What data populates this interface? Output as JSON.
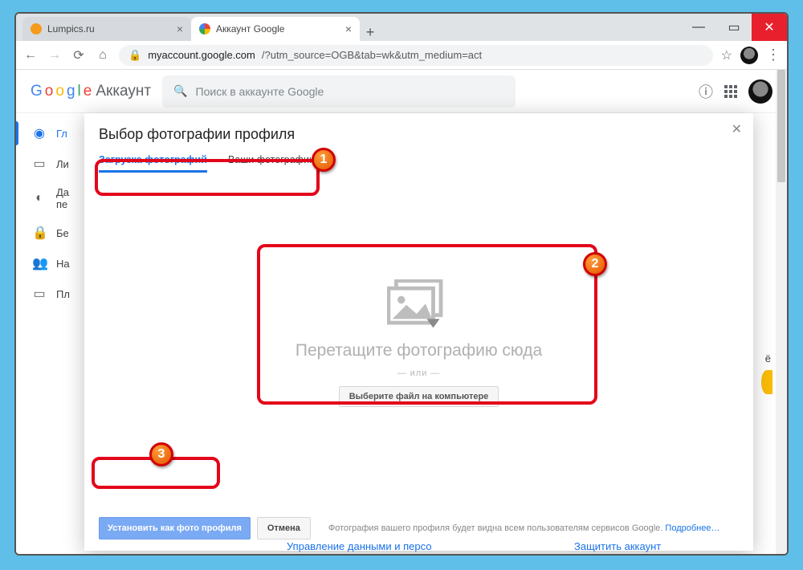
{
  "browser": {
    "tabs": [
      {
        "title": "Lumpics.ru",
        "favicon": "#f59a1b",
        "active": false
      },
      {
        "title": "Аккаунт Google",
        "favicon": "google",
        "active": true
      }
    ],
    "url_host": "myaccount.google.com",
    "url_path": "/?utm_source=OGB&tab=wk&utm_medium=act"
  },
  "header": {
    "product": "Аккаунт",
    "search_placeholder": "Поиск в аккаунте Google"
  },
  "sidebar": {
    "items": [
      {
        "label": "Гл",
        "icon": "user-circle",
        "active": true
      },
      {
        "label": "Ли",
        "icon": "id-card",
        "active": false
      },
      {
        "label_line1": "Да",
        "label_line2": "пе",
        "icon": "toggle",
        "active": false
      },
      {
        "label": "Бе",
        "icon": "lock",
        "active": false
      },
      {
        "label": "На",
        "icon": "people",
        "active": false
      },
      {
        "label": "Пл",
        "icon": "card",
        "active": false
      }
    ]
  },
  "dialog": {
    "title": "Выбор фотографии профиля",
    "tabs": {
      "upload": "Загрузка фотографий",
      "yours": "Ваши фотографии"
    },
    "drop_text": "Перетащите фотографию сюда",
    "or": "— или —",
    "pick_button": "Выберите файл на компьютере",
    "set_button": "Установить как фото профиля",
    "cancel_button": "Отмена",
    "note": "Фотография вашего профиля будет видна всем пользователям сервисов Google.",
    "more": "Подробнее…"
  },
  "peek": {
    "text": "ё"
  },
  "links": {
    "manage": "Управление данными и персо",
    "protect": "Защитить аккаунт"
  },
  "annotations": {
    "b1": "1",
    "b2": "2",
    "b3": "3"
  }
}
